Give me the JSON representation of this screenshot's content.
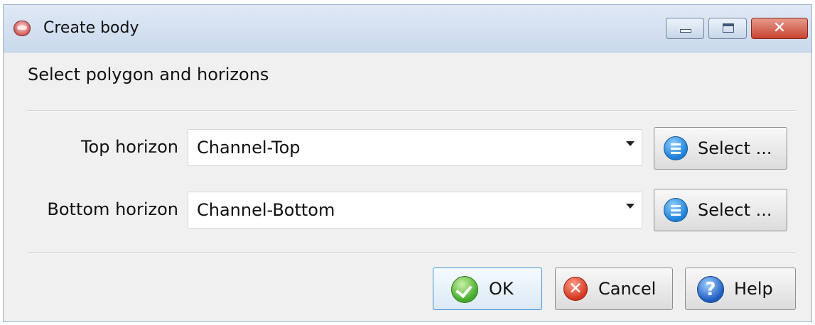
{
  "window": {
    "title": "Create body",
    "controls": {
      "minimize": "minimize",
      "maximize": "maximize",
      "close": "✕"
    }
  },
  "heading": "Select polygon and horizons",
  "fields": [
    {
      "label": "Top horizon",
      "value": "Channel-Top",
      "select_label": "Select ..."
    },
    {
      "label": "Bottom horizon",
      "value": "Channel-Bottom",
      "select_label": "Select ..."
    }
  ],
  "buttons": {
    "ok": "OK",
    "cancel": "Cancel",
    "help": "Help"
  },
  "icons": {
    "app": "app-icon",
    "list": "list-icon",
    "ok": "check-icon",
    "cancel": "cancel-icon",
    "help": "help-icon"
  },
  "colors": {
    "ok_border": "#3c8fd8",
    "title_bar": "#c9d9ec",
    "close_button": "#c84432"
  }
}
